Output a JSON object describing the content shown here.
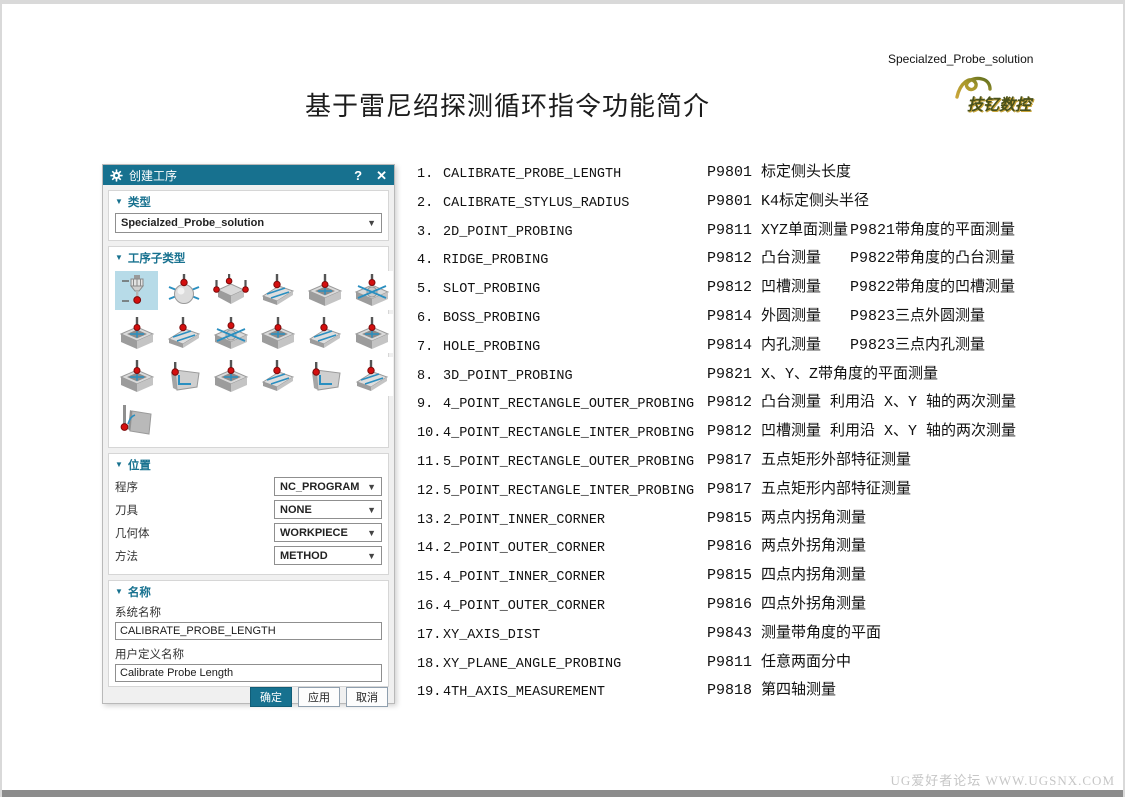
{
  "page": {
    "title": "基于雷尼绍探测循环指令功能简介",
    "watermark": "UG爱好者论坛 WWW.UGSNX.COM",
    "header_right": {
      "caption": "Specialzed_Probe_solution",
      "logo_text": "技钇数控"
    }
  },
  "colors": {
    "accent_teal": "#17718f",
    "selected_icon_bg": "#b7dbe8",
    "logo_gold": "#c9a53a",
    "logo_green": "#49511a",
    "watermark_gray": "#c6c6c6",
    "probe_red": "#d40f0f",
    "probe_blue": "#2a8fc0"
  },
  "dialog": {
    "title": "创建工序",
    "help_label": "?",
    "close_label": "✕",
    "sections": {
      "type": {
        "label": "类型",
        "value": "Specialzed_Probe_solution"
      },
      "subtype": {
        "label": "工序子类型",
        "icons": [
          {
            "name": "calibrate-probe-length",
            "variant": "tool",
            "selected": true
          },
          {
            "name": "calibrate-stylus-radius",
            "variant": "sphere",
            "selected": false
          },
          {
            "name": "2d-point-probing",
            "variant": "twoprobe",
            "selected": false
          },
          {
            "name": "ridge-probing",
            "variant": "plane",
            "selected": false
          },
          {
            "name": "slot-probing",
            "variant": "pocket",
            "selected": false
          },
          {
            "name": "boss-probing",
            "variant": "boss",
            "selected": false
          },
          {
            "name": "hole-probing",
            "variant": "pocket",
            "selected": false
          },
          {
            "name": "3d-point-probing",
            "variant": "plane",
            "selected": false
          },
          {
            "name": "4-point-rectangle-outer-probing",
            "variant": "boss",
            "selected": false
          },
          {
            "name": "4-point-rectangle-inter-probing",
            "variant": "pocket",
            "selected": false
          },
          {
            "name": "5-point-rectangle-outer-probing",
            "variant": "plane",
            "selected": false
          },
          {
            "name": "5-point-rectangle-inter-probing",
            "variant": "pocket",
            "selected": false
          },
          {
            "name": "2-point-inner-corner",
            "variant": "pocket",
            "selected": false
          },
          {
            "name": "2-point-outer-corner",
            "variant": "corner",
            "selected": false
          },
          {
            "name": "4-point-inner-corner",
            "variant": "pocket",
            "selected": false
          },
          {
            "name": "4-point-outer-corner",
            "variant": "plane",
            "selected": false
          },
          {
            "name": "xy-axis-dist",
            "variant": "corner",
            "selected": false
          },
          {
            "name": "xy-plane-angle-probing",
            "variant": "plane",
            "selected": false
          },
          {
            "name": "4th-axis-measurement",
            "variant": "axis4",
            "selected": false
          }
        ]
      },
      "location": {
        "label": "位置",
        "rows": [
          {
            "key": "program",
            "label": "程序",
            "value": "NC_PROGRAM"
          },
          {
            "key": "tool",
            "label": "刀具",
            "value": "NONE"
          },
          {
            "key": "geometry",
            "label": "几何体",
            "value": "WORKPIECE"
          },
          {
            "key": "method",
            "label": "方法",
            "value": "METHOD"
          }
        ]
      },
      "name": {
        "label": "名称",
        "system_name_label": "系统名称",
        "system_name_value": "CALIBRATE_PROBE_LENGTH",
        "user_name_label": "用户定义名称",
        "user_name_value": "Calibrate Probe Length"
      }
    },
    "buttons": {
      "ok": "确定",
      "apply": "应用",
      "cancel": "取消"
    }
  },
  "list": {
    "items": [
      {
        "num": "1.",
        "name": "CALIBRATE_PROBE_LENGTH",
        "code": "P9801 标定侧头长度",
        "extra": ""
      },
      {
        "num": "2.",
        "name": "CALIBRATE_STYLUS_RADIUS",
        "code": "P9801 K4标定侧头半径",
        "extra": ""
      },
      {
        "num": "3.",
        "name": "2D_POINT_PROBING",
        "code": "P9811 XYZ单面测量",
        "extra": "P9821带角度的平面测量"
      },
      {
        "num": "4.",
        "name": "RIDGE_PROBING",
        "code": "P9812 凸台测量",
        "extra": "P9822带角度的凸台测量"
      },
      {
        "num": "5.",
        "name": "SLOT_PROBING",
        "code": "P9812 凹槽测量",
        "extra": "P9822带角度的凹槽测量"
      },
      {
        "num": "6.",
        "name": "BOSS_PROBING",
        "code": "P9814 外圆测量",
        "extra": "P9823三点外圆测量"
      },
      {
        "num": "7.",
        "name": "HOLE_PROBING",
        "code": "P9814 内孔测量",
        "extra": "P9823三点内孔测量"
      },
      {
        "num": "8.",
        "name": "3D_POINT_PROBING",
        "code": "P9821 X、Y、Z带角度的平面测量",
        "extra": ""
      },
      {
        "num": "9.",
        "name": "4_POINT_RECTANGLE_OUTER_PROBING",
        "code": "P9812 凸台测量 利用沿 X、Y 轴的两次测量",
        "extra": ""
      },
      {
        "num": "10.",
        "name": "4_POINT_RECTANGLE_INTER_PROBING",
        "code": "P9812 凹槽测量 利用沿 X、Y 轴的两次测量",
        "extra": ""
      },
      {
        "num": "11.",
        "name": "5_POINT_RECTANGLE_OUTER_PROBING",
        "code": "P9817 五点矩形外部特征测量",
        "extra": ""
      },
      {
        "num": "12.",
        "name": "5_POINT_RECTANGLE_INTER_PROBING",
        "code": "P9817 五点矩形内部特征测量",
        "extra": ""
      },
      {
        "num": "13.",
        "name": "2_POINT_INNER_CORNER",
        "code": "P9815 两点内拐角测量",
        "extra": ""
      },
      {
        "num": "14.",
        "name": "2_POINT_OUTER_CORNER",
        "code": "P9816 两点外拐角测量",
        "extra": ""
      },
      {
        "num": "15.",
        "name": "4_POINT_INNER_CORNER",
        "code": "P9815 四点内拐角测量",
        "extra": ""
      },
      {
        "num": "16.",
        "name": "4_POINT_OUTER_CORNER",
        "code": "P9816 四点外拐角测量",
        "extra": ""
      },
      {
        "num": "17.",
        "name": "XY_AXIS_DIST",
        "code": "P9843 测量带角度的平面",
        "extra": ""
      },
      {
        "num": "18.",
        "name": "XY_PLANE_ANGLE_PROBING",
        "code": "P9811 任意两面分中",
        "extra": ""
      },
      {
        "num": "19.",
        "name": "4TH_AXIS_MEASUREMENT",
        "code": "P9818 第四轴测量",
        "extra": ""
      }
    ]
  }
}
